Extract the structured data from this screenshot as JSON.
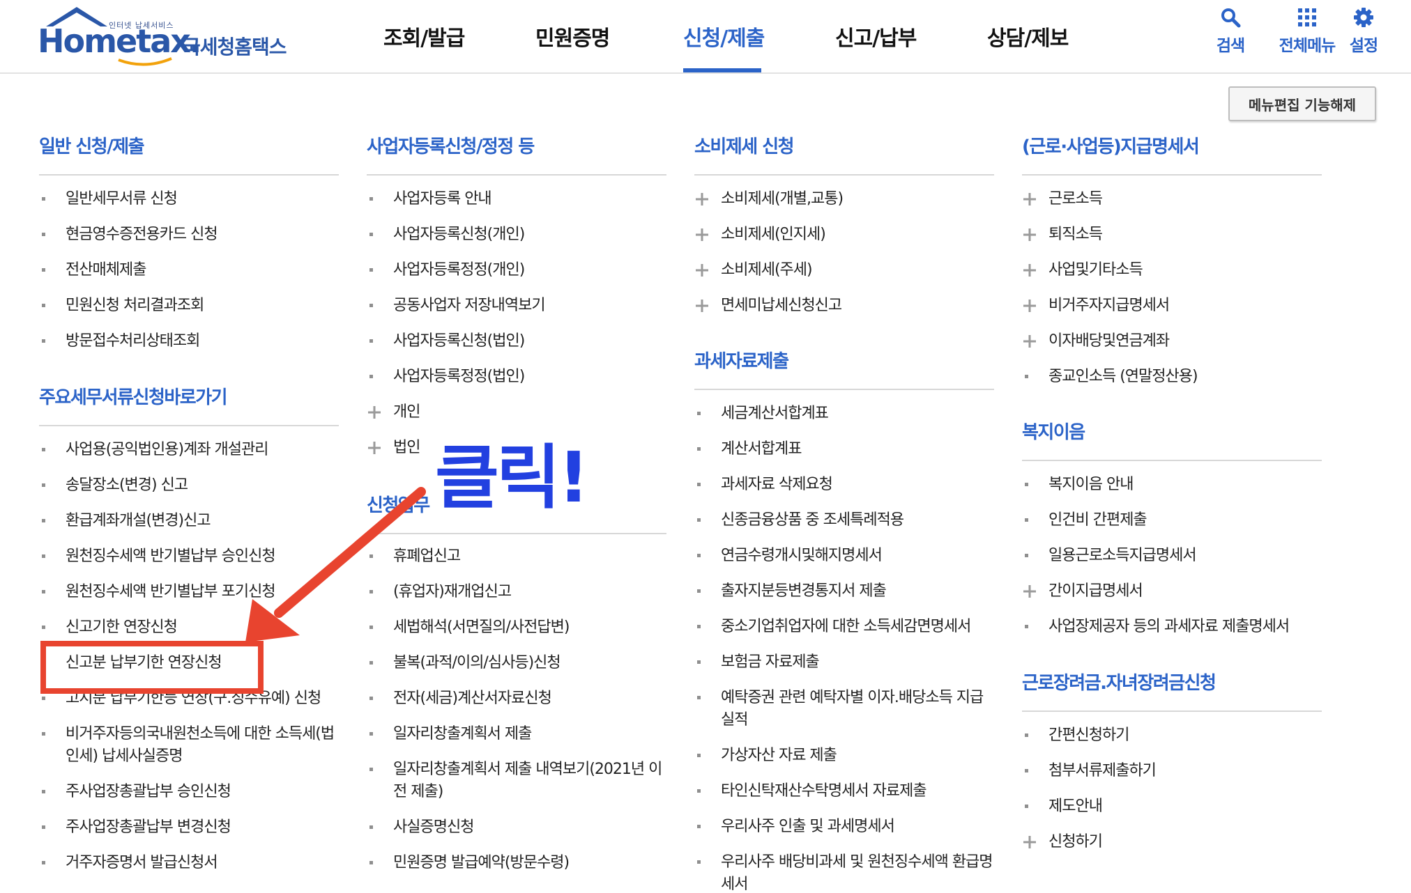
{
  "header": {
    "logo": {
      "small_text": "인터넷 납세서비스",
      "main_text": "Hometax.",
      "sub_text": "국세청홈택스"
    },
    "nav": [
      {
        "label": "조회/발급",
        "active": false
      },
      {
        "label": "민원증명",
        "active": false
      },
      {
        "label": "신청/제출",
        "active": true
      },
      {
        "label": "신고/납부",
        "active": false
      },
      {
        "label": "상담/제보",
        "active": false
      }
    ],
    "utilities": [
      {
        "label": "검색",
        "icon": "search-icon"
      },
      {
        "label": "전체메뉴",
        "icon": "grid-menu-icon"
      },
      {
        "label": "설정",
        "icon": "gear-icon"
      }
    ],
    "accent_color": "#2b63c8"
  },
  "edit_menu_button": "메뉴편집 기능해제",
  "columns": [
    {
      "sections": [
        {
          "title": "일반 신청/제출",
          "items": [
            {
              "label": "일반세무서류 신청",
              "marker": "bullet"
            },
            {
              "label": "현금영수증전용카드 신청",
              "marker": "bullet"
            },
            {
              "label": "전산매체제출",
              "marker": "bullet"
            },
            {
              "label": "민원신청 처리결과조회",
              "marker": "bullet"
            },
            {
              "label": "방문접수처리상태조회",
              "marker": "bullet"
            }
          ]
        },
        {
          "title": "주요세무서류신청바로가기",
          "items": [
            {
              "label": "사업용(공익법인용)계좌 개설관리",
              "marker": "bullet"
            },
            {
              "label": "송달장소(변경) 신고",
              "marker": "bullet"
            },
            {
              "label": "환급계좌개설(변경)신고",
              "marker": "bullet"
            },
            {
              "label": "원천징수세액 반기별납부 승인신청",
              "marker": "bullet"
            },
            {
              "label": "원천징수세액 반기별납부 포기신청",
              "marker": "bullet"
            },
            {
              "label": "신고기한 연장신청",
              "marker": "bullet"
            },
            {
              "label": "신고분 납부기한 연장신청",
              "marker": "bullet"
            },
            {
              "label": "고지분 납부기한등 연장(구.징수유예) 신청",
              "marker": "bullet"
            },
            {
              "label": "비거주자등의국내원천소득에 대한 소득세(법인세) 납세사실증명",
              "marker": "bullet",
              "multi": true
            },
            {
              "label": "주사업장총괄납부 승인신청",
              "marker": "bullet"
            },
            {
              "label": "주사업장총괄납부 변경신청",
              "marker": "bullet"
            },
            {
              "label": "거주자증명서 발급신청서",
              "marker": "bullet"
            }
          ]
        }
      ]
    },
    {
      "sections": [
        {
          "title": "사업자등록신청/정정 등",
          "items": [
            {
              "label": "사업자등록 안내",
              "marker": "bullet"
            },
            {
              "label": "사업자등록신청(개인)",
              "marker": "bullet"
            },
            {
              "label": "사업자등록정정(개인)",
              "marker": "bullet"
            },
            {
              "label": "공동사업자 저장내역보기",
              "marker": "bullet"
            },
            {
              "label": "사업자등록신청(법인)",
              "marker": "bullet"
            },
            {
              "label": "사업자등록정정(법인)",
              "marker": "bullet"
            },
            {
              "label": "개인",
              "marker": "plus"
            },
            {
              "label": "법인",
              "marker": "plus"
            }
          ]
        },
        {
          "title": "신청업무",
          "items": [
            {
              "label": "휴폐업신고",
              "marker": "bullet"
            },
            {
              "label": "(휴업자)재개업신고",
              "marker": "bullet"
            },
            {
              "label": "세법해석(서면질의/사전답변)",
              "marker": "bullet"
            },
            {
              "label": "불복(과적/이의/심사등)신청",
              "marker": "bullet"
            },
            {
              "label": "전자(세금)계산서자료신청",
              "marker": "bullet"
            },
            {
              "label": "일자리창출계획서 제출",
              "marker": "bullet"
            },
            {
              "label": "일자리창출계획서 제출 내역보기(2021년 이전 제출)",
              "marker": "bullet",
              "multi": true
            },
            {
              "label": "사실증명신청",
              "marker": "bullet"
            },
            {
              "label": "민원증명 발급예약(방문수령)",
              "marker": "bullet"
            }
          ]
        }
      ]
    },
    {
      "sections": [
        {
          "title": "소비제세 신청",
          "items": [
            {
              "label": "소비제세(개별,교통)",
              "marker": "plus"
            },
            {
              "label": "소비제세(인지세)",
              "marker": "plus"
            },
            {
              "label": "소비제세(주세)",
              "marker": "plus"
            },
            {
              "label": "면세미납세신청신고",
              "marker": "plus"
            }
          ]
        },
        {
          "title": "과세자료제출",
          "items": [
            {
              "label": "세금계산서합계표",
              "marker": "bullet"
            },
            {
              "label": "계산서합계표",
              "marker": "bullet"
            },
            {
              "label": "과세자료 삭제요청",
              "marker": "bullet"
            },
            {
              "label": "신종금융상품 중 조세특례적용",
              "marker": "bullet"
            },
            {
              "label": "연금수령개시및해지명세서",
              "marker": "bullet"
            },
            {
              "label": "출자지분등변경통지서 제출",
              "marker": "bullet"
            },
            {
              "label": "중소기업취업자에 대한 소득세감면명세서",
              "marker": "bullet"
            },
            {
              "label": "보험금 자료제출",
              "marker": "bullet"
            },
            {
              "label": "예탁증권 관련 예탁자별 이자.배당소득 지급실적",
              "marker": "bullet",
              "multi": true
            },
            {
              "label": "가상자산 자료 제출",
              "marker": "bullet"
            },
            {
              "label": "타인신탁재산수탁명세서 자료제출",
              "marker": "bullet"
            },
            {
              "label": "우리사주 인출 및 과세명세서",
              "marker": "bullet"
            },
            {
              "label": "우리사주 배당비과세 및 원천징수세액 환급명세서",
              "marker": "bullet",
              "multi": true
            }
          ]
        }
      ]
    },
    {
      "sections": [
        {
          "title": "(근로·사업등)지급명세서",
          "items": [
            {
              "label": "근로소득",
              "marker": "plus"
            },
            {
              "label": "퇴직소득",
              "marker": "plus"
            },
            {
              "label": "사업및기타소득",
              "marker": "plus"
            },
            {
              "label": "비거주자지급명세서",
              "marker": "plus"
            },
            {
              "label": "이자배당및연금계좌",
              "marker": "plus"
            },
            {
              "label": "종교인소득 (연말정산용)",
              "marker": "bullet"
            }
          ]
        },
        {
          "title": "복지이음",
          "items": [
            {
              "label": "복지이음 안내",
              "marker": "bullet"
            },
            {
              "label": "인건비 간편제출",
              "marker": "bullet"
            },
            {
              "label": "일용근로소득지급명세서",
              "marker": "bullet"
            },
            {
              "label": "간이지급명세서",
              "marker": "plus"
            },
            {
              "label": "사업장제공자 등의 과세자료 제출명세서",
              "marker": "bullet"
            }
          ]
        },
        {
          "title": "근로장려금.자녀장려금신청",
          "items": [
            {
              "label": "간편신청하기",
              "marker": "bullet"
            },
            {
              "label": "첨부서류제출하기",
              "marker": "bullet"
            },
            {
              "label": "제도안내",
              "marker": "bullet"
            },
            {
              "label": "신청하기",
              "marker": "plus"
            }
          ]
        }
      ]
    }
  ],
  "annotation": {
    "click_text": "클릭!",
    "highlight_color": "#e8442f",
    "click_color": "#2240e0"
  }
}
